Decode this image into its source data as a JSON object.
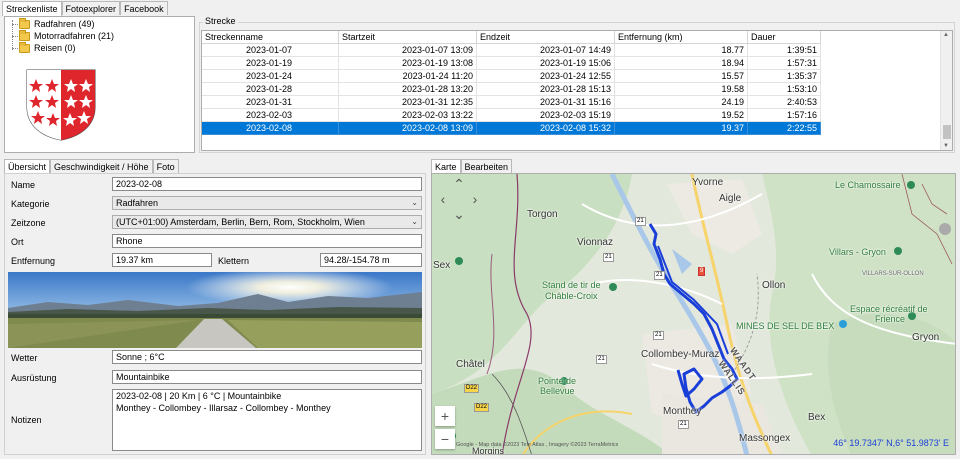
{
  "top_tabs": [
    "Streckenliste",
    "Fotoexplorer",
    "Facebook"
  ],
  "tree": {
    "items": [
      {
        "label": "Radfahren (49)"
      },
      {
        "label": "Motorradfahren (21)"
      },
      {
        "label": "Reisen (0)"
      }
    ]
  },
  "routes": {
    "title": "Strecke",
    "columns": [
      "Streckenname",
      "Startzeit",
      "Endzeit",
      "Entfernung (km)",
      "Dauer"
    ],
    "rows": [
      [
        "2023-01-07",
        "2023-01-07 13:09",
        "2023-01-07 14:49",
        "18.77",
        "1:39:51"
      ],
      [
        "2023-01-19",
        "2023-01-19 13:08",
        "2023-01-19 15:06",
        "18.94",
        "1:57:31"
      ],
      [
        "2023-01-24",
        "2023-01-24 11:20",
        "2023-01-24 12:55",
        "15.57",
        "1:35:37"
      ],
      [
        "2023-01-28",
        "2023-01-28 13:20",
        "2023-01-28 15:13",
        "19.58",
        "1:53:10"
      ],
      [
        "2023-01-31",
        "2023-01-31 12:35",
        "2023-01-31 15:16",
        "24.19",
        "2:40:53"
      ],
      [
        "2023-02-03",
        "2023-02-03 13:22",
        "2023-02-03 15:19",
        "19.52",
        "1:57:16"
      ],
      [
        "2023-02-08",
        "2023-02-08 13:09",
        "2023-02-08 15:32",
        "19.37",
        "2:22:55"
      ]
    ],
    "selected_index": 6,
    "selection_color": "#0078d7"
  },
  "detail_tabs": [
    "Übersicht",
    "Geschwindigkeit / Höhe",
    "Foto"
  ],
  "detail": {
    "name_label": "Name",
    "name_value": "2023-02-08",
    "category_label": "Kategorie",
    "category_value": "Radfahren",
    "timezone_label": "Zeitzone",
    "timezone_value": "(UTC+01:00) Amsterdam, Berlin, Bern, Rom, Stockholm, Wien",
    "place_label": "Ort",
    "place_value": "Rhone",
    "distance_label": "Entfernung",
    "distance_value": "19.37 km",
    "climb_label": "Klettern",
    "climb_value": "94.28/-154.78 m",
    "weather_label": "Wetter",
    "weather_value": "Sonne ;  6°C",
    "equipment_label": "Ausrüstung",
    "equipment_value": "Mountainbike",
    "notes_label": "Notizen",
    "notes_line1": "2023-02-08  | 20 Km | 6 °C | Mountainbike",
    "notes_line2": "Monthey - Collombey - Illarsaz - Collombey - Monthey"
  },
  "map_tabs": [
    "Karte",
    "Bearbeiten"
  ],
  "map": {
    "places": {
      "yvorne": "Yvorne",
      "aigle": "Aigle",
      "torgon": "Torgon",
      "vionnaz": "Vionnaz",
      "chamossaire": "Le Chamossaire",
      "villars": "Villars - Gryon",
      "villars_sur_ollon": "VILLARS-SUR-OLLON",
      "ollon": "Ollon",
      "stand_tir": "Stand de tir de",
      "chable_croix": "Châble-Croix",
      "espace1": "Espace récréatif de",
      "espace2": "Frience",
      "mines": "MINES DE SEL DE BEX",
      "gryon": "Gryon",
      "chatel": "Châtel",
      "collombey": "Collombey-Muraz",
      "waadt": "WAADT",
      "wallis": "WALLIS",
      "pointe1": "Pointe de",
      "pointe2": "Bellevue",
      "monthey": "Monthey",
      "bex": "Bex",
      "massongex": "Massongex",
      "sex": "Sex",
      "morgins": "Morgins"
    },
    "roads": [
      "21",
      "21",
      "21",
      "9",
      "21",
      "21",
      "D22",
      "D22",
      "21"
    ],
    "attribution": "Google - Map data ©2023 Tele Atlas , Imagery ©2023 TerraMetrics",
    "coordinates": "46° 19.7347' N,6° 51.9873' E",
    "route_color": "#1a3fd8",
    "zoom_in": "+",
    "zoom_out": "−"
  }
}
